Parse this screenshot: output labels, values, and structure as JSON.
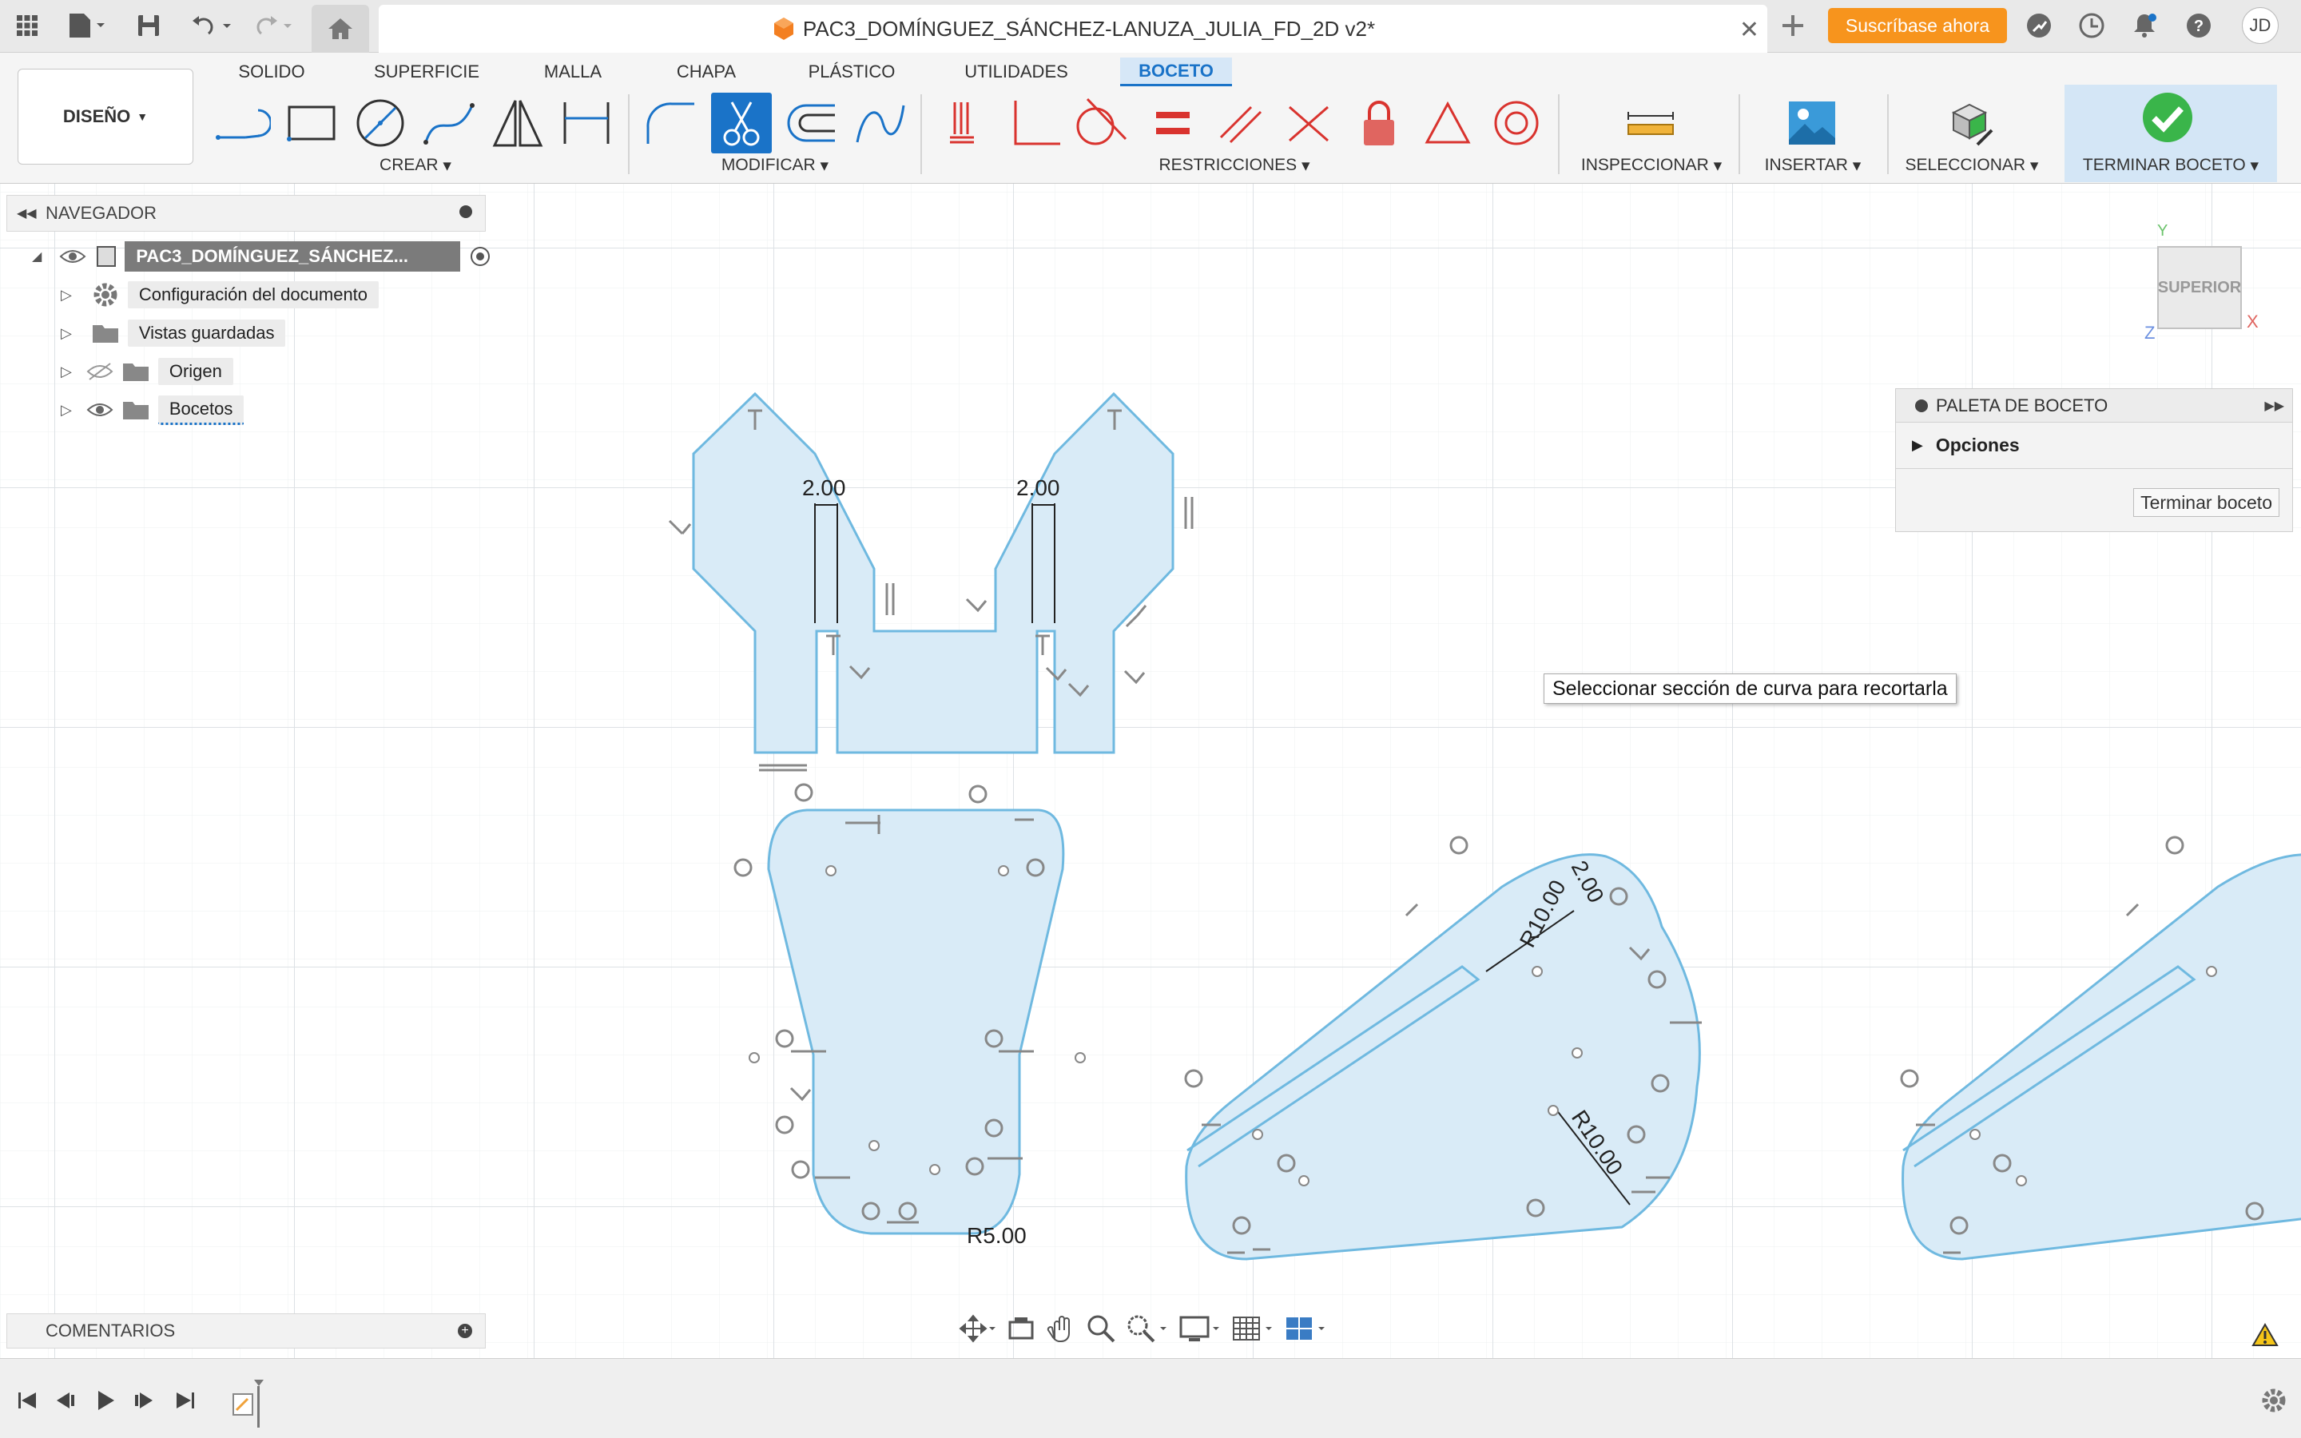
{
  "document": {
    "title": "PAC3_DOMÍNGUEZ_SÁNCHEZ-LANUZA_JULIA_FD_2D v2*",
    "subscribe_label": "Suscríbase ahora",
    "user_initials": "JD"
  },
  "ribbon": {
    "workspace_label": "DISEÑO",
    "tabs": [
      {
        "label": "SOLIDO"
      },
      {
        "label": "SUPERFICIE"
      },
      {
        "label": "MALLA"
      },
      {
        "label": "CHAPA"
      },
      {
        "label": "PLÁSTICO"
      },
      {
        "label": "UTILIDADES"
      },
      {
        "label": "BOCETO",
        "active": true
      }
    ],
    "groups": {
      "create": "CREAR",
      "modify": "MODIFICAR",
      "constraints": "RESTRICCIONES",
      "inspect": "INSPECCIONAR",
      "insert": "INSERTAR",
      "select": "SELECCIONAR",
      "finish": "TERMINAR BOCETO"
    },
    "selected_tool": "trim"
  },
  "browser": {
    "title": "NAVEGADOR",
    "root": "PAC3_DOMÍNGUEZ_SÁNCHEZ...",
    "items": [
      {
        "label": "Configuración del documento",
        "icon": "gear-icon"
      },
      {
        "label": "Vistas guardadas",
        "icon": "folder-icon"
      },
      {
        "label": "Origen",
        "icon": "folder-icon",
        "visible": false
      },
      {
        "label": "Bocetos",
        "icon": "folder-icon",
        "visible": true
      }
    ]
  },
  "viewcube": {
    "face": "SUPERIOR",
    "axis_y": "Y",
    "axis_x": "X",
    "axis_z": "Z"
  },
  "palette": {
    "title": "PALETA DE BOCETO",
    "section": "Opciones",
    "finish_button": "Terminar boceto"
  },
  "tooltip": "Seleccionar sección de curva para recortarla",
  "comments": {
    "title": "COMENTARIOS"
  },
  "dimensions": {
    "d1": "2.00",
    "d2": "2.00",
    "d3": "R5.00",
    "d4": "R10.00",
    "d5": "2.00",
    "d6": "R10.00"
  },
  "colors": {
    "sketch_fill": "#d9ebf7",
    "sketch_stroke": "#6fb9e0",
    "accent": "#1a73c8",
    "subscribe": "#f7941d",
    "finish_check": "#3ab54a"
  }
}
